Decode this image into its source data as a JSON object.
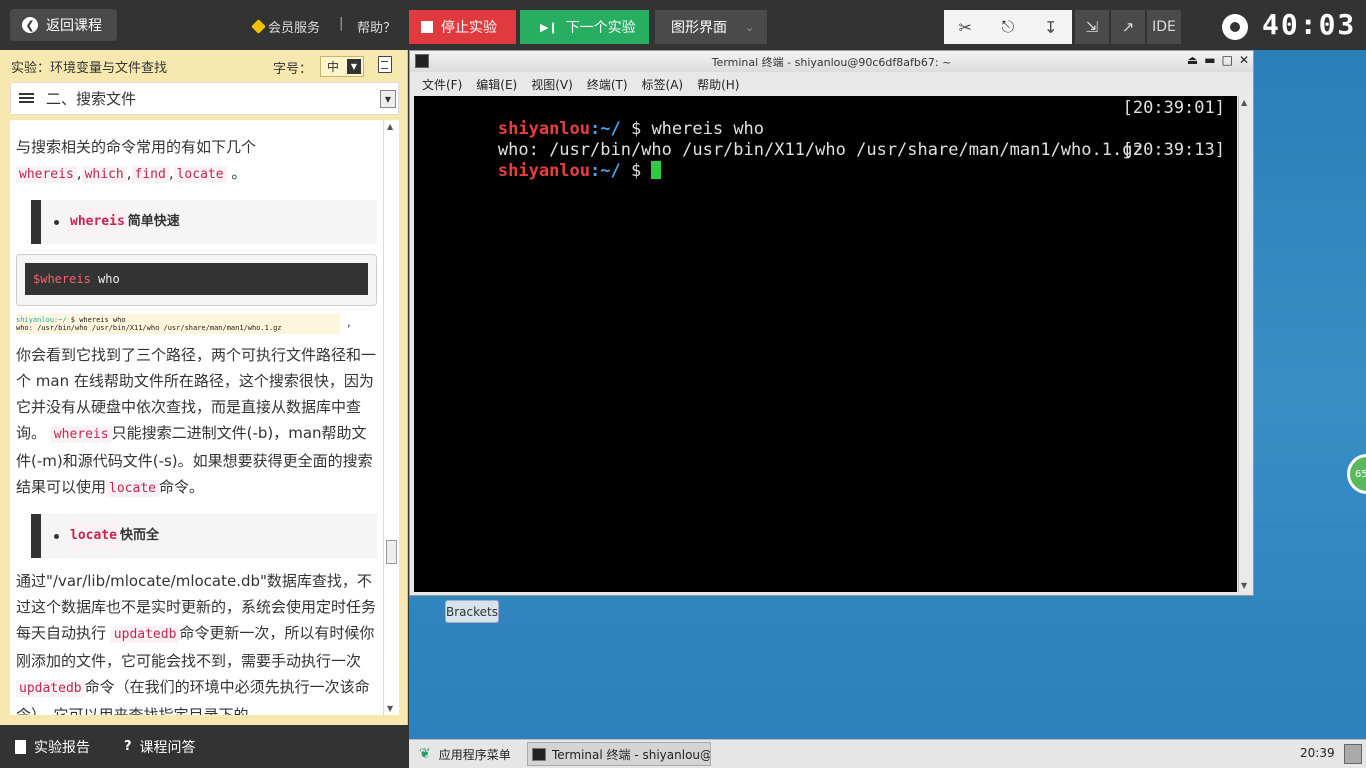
{
  "topbar": {
    "back_label": "返回课程",
    "member_label": "会员服务",
    "separator": "|",
    "help_label": "帮助？",
    "stop_label": "停止实验",
    "next_label": "下一个实验",
    "gui_label": "图形界面",
    "ide_label": "IDE",
    "timer": "40:03"
  },
  "doc": {
    "experiment_title": "实验：环境变量与文件查找",
    "font_label": "字号：",
    "font_value": "中",
    "toc_current": "二、搜索文件",
    "p1a": "与搜索相关的命令常用的有如下几个",
    "cmd_whereis": "whereis",
    "cmd_which": "which",
    "cmd_find": "find",
    "cmd_locate": "locate",
    "sep_comma": ",",
    "p1_end": "。",
    "bq1_text": "简单快速",
    "code_cmd": "$whereis",
    "code_arg": " who",
    "mini_prompt": "shiyanlou:~/",
    "mini_cmd": " $ whereis who",
    "mini_out": "who: /usr/bin/who /usr/bin/X11/who /usr/share/man/man1/who.1.gz",
    "mini_comma": ",",
    "p2a": "你会看到它找到了三个路径，两个可执行文件路径和一个 man 在线帮助文件所在路径，这个搜索很快，因为它并没有从硬盘中依次查找，而是直接从数据库中查询。",
    "p2b": "只能搜索二进制文件(-b)，man帮助文件(-m)和源代码文件(-s)。如果想要获得更全面的搜索结果可以使用",
    "p2c": "命令。",
    "bq2_text": "快而全",
    "p3a": "通过\"/var/lib/mlocate/mlocate.db\"数据库查找，不过这个数据库也不是实时更新的，系统会使用定时任务每天自动执行",
    "cmd_updatedb": "updatedb",
    "p3b": "命令更新一次，所以有时候你刚添加的文件，它可能会找不到，需要手动执行一次",
    "p3c": "命令（在我们的环境中必须先执行一次该命令）。它可以用来查找指定目录下的"
  },
  "bottom": {
    "report_label": "实验报告",
    "qa_label": "课程问答"
  },
  "terminal": {
    "title": "Terminal 终端 - shiyanlou@90c6df8afb67: ~",
    "menu": [
      "文件(F)",
      "编辑(E)",
      "视图(V)",
      "终端(T)",
      "标签(A)",
      "帮助(H)"
    ],
    "prompt_user": "shiyanlou",
    "prompt_path": ":~/",
    "line1_cmd": " $ whereis who",
    "line1_time": "[20:39:01]",
    "line2_out": "who: /usr/bin/who /usr/bin/X11/who /usr/share/man/man1/who.1.gz",
    "line3_cmd": " $ ",
    "line3_time": "[20:39:13]"
  },
  "desktop": {
    "brackets_label": "Brackets",
    "badge_text": "65"
  },
  "taskbar": {
    "apps_label": "应用程序菜单",
    "task_label": "Terminal 终端 - shiyanlou@…",
    "clock": "20:39"
  }
}
